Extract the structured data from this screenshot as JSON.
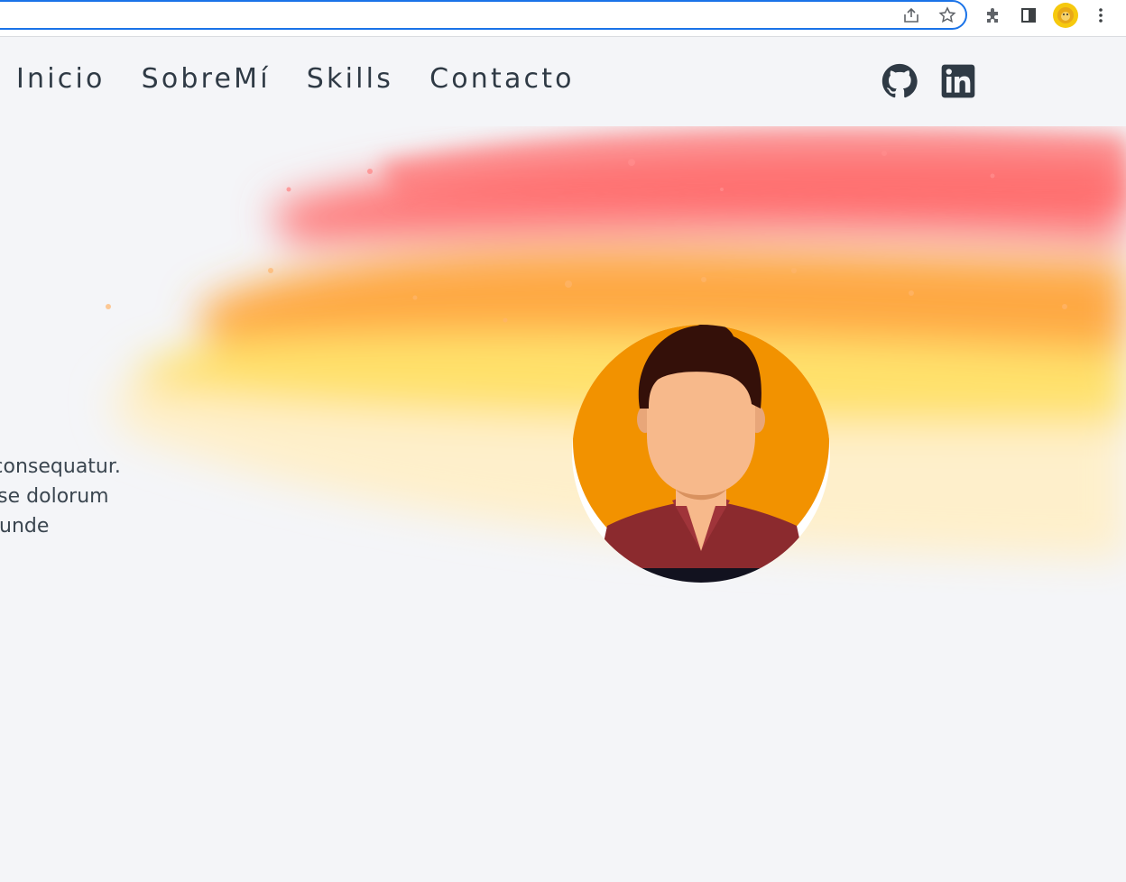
{
  "browser": {
    "icons": [
      "share-icon",
      "star-icon",
      "extensions-icon",
      "side-panel-icon",
      "profile-avatar",
      "more-icon"
    ]
  },
  "nav": {
    "items": [
      {
        "label": "Inicio"
      },
      {
        "label": "SobreMí"
      },
      {
        "label": "Skills"
      },
      {
        "label": "Contacto"
      }
    ]
  },
  "social": {
    "icons": [
      "github-icon",
      "linkedin-icon"
    ]
  },
  "hero": {
    "text_lines": "m, consequatur.\n! Esse dolorum\nuta unde"
  },
  "colors": {
    "page_background": "#f4f5f8",
    "nav_text": "#2f3a45",
    "splash_red": "#ff6b6b",
    "splash_orange": "#ffa43a",
    "splash_yellow": "#ffe066",
    "avatar_background": "#f29200",
    "shirt": "#8b2a2e",
    "hair": "#341009",
    "skin": "#f7b98b"
  }
}
